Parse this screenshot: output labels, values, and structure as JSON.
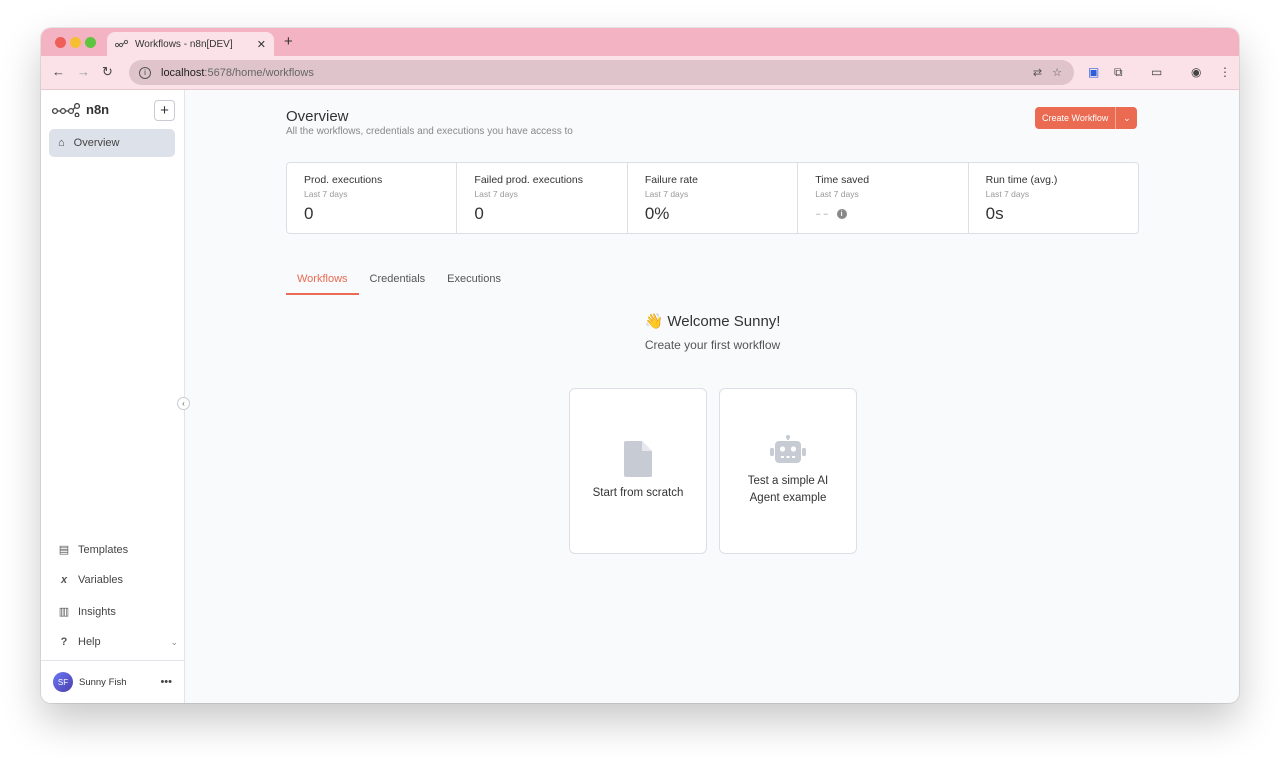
{
  "browser": {
    "tab_title": "Workflows - n8n[DEV]",
    "tab_close": "✕",
    "new_tab": "+",
    "url_host": "localhost",
    "url_path": ":5678/home/workflows"
  },
  "sidebar": {
    "logo_text": "n8n",
    "add_label": "+",
    "items": {
      "overview": "Overview",
      "templates": "Templates",
      "variables": "Variables",
      "insights": "Insights",
      "help": "Help"
    },
    "user": {
      "initials": "SF",
      "name": "Sunny Fish"
    }
  },
  "main": {
    "title": "Overview",
    "subtitle": "All the workflows, credentials and executions you have access to",
    "create_button": "Create Workflow",
    "stats": [
      {
        "label": "Prod. executions",
        "period": "Last 7 days",
        "value": "0"
      },
      {
        "label": "Failed prod. executions",
        "period": "Last 7 days",
        "value": "0"
      },
      {
        "label": "Failure rate",
        "period": "Last 7 days",
        "value": "0%"
      },
      {
        "label": "Time saved",
        "period": "Last 7 days",
        "value": "--"
      },
      {
        "label": "Run time (avg.)",
        "period": "Last 7 days",
        "value": "0s"
      }
    ],
    "tabs": {
      "workflows": "Workflows",
      "credentials": "Credentials",
      "executions": "Executions"
    },
    "welcome": "👋 Welcome Sunny!",
    "welcome_sub": "Create your first workflow",
    "cards": {
      "scratch": "Start from scratch",
      "ai_line1": "Test a simple AI",
      "ai_line2": "Agent example"
    }
  },
  "colors": {
    "accent": "#ea6b52",
    "tabstrip": "#f4b3c2"
  }
}
